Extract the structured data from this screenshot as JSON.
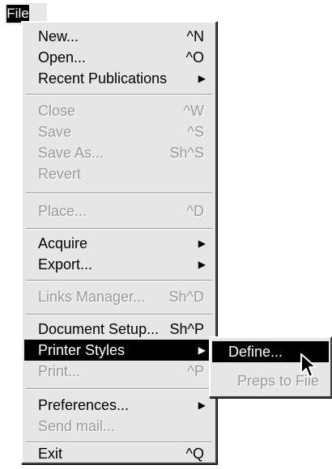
{
  "menubar": {
    "file": "File"
  },
  "file_menu": {
    "new": {
      "label": "New...",
      "shortcut": "^N"
    },
    "open": {
      "label": "Open...",
      "shortcut": "^O"
    },
    "recent": {
      "label": "Recent Publications"
    },
    "close": {
      "label": "Close",
      "shortcut": "^W"
    },
    "save": {
      "label": "Save",
      "shortcut": "^S"
    },
    "save_as": {
      "label": "Save As...",
      "shortcut": "Sh^S"
    },
    "revert": {
      "label": "Revert"
    },
    "place": {
      "label": "Place...",
      "shortcut": "^D"
    },
    "acquire": {
      "label": "Acquire"
    },
    "export": {
      "label": "Export..."
    },
    "links_manager": {
      "label": "Links Manager...",
      "shortcut": "Sh^D"
    },
    "document_setup": {
      "label": "Document Setup...",
      "shortcut": "Sh^P"
    },
    "printer_styles": {
      "label": "Printer Styles"
    },
    "print": {
      "label": "Print...",
      "shortcut": "^P"
    },
    "preferences": {
      "label": "Preferences..."
    },
    "send_mail": {
      "label": "Send mail..."
    },
    "exit": {
      "label": "Exit",
      "shortcut": "^Q"
    }
  },
  "printer_styles_submenu": {
    "define": "Define...",
    "preps_to_file": "Preps to File"
  },
  "colors": {
    "highlight": "#000000",
    "menu_bg": "#e6e6e6",
    "disabled_text": "#9a9a9a"
  },
  "icons": {
    "submenu_arrow": "triangle-right",
    "cursor": "arrow-pointer"
  }
}
